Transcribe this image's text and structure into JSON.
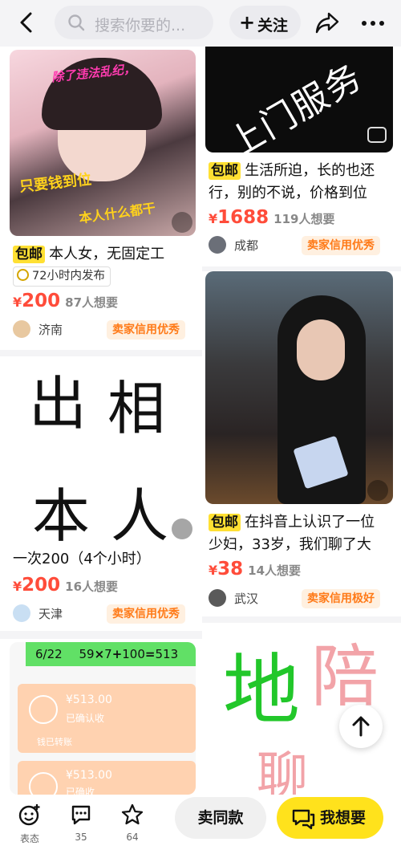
{
  "search": {
    "placeholder": "搜索你要的..."
  },
  "header": {
    "follow_label": "关注"
  },
  "cards": [
    {
      "overlay": [
        "除了违法乱纪，",
        "只要钱到位",
        "本人什么都干"
      ],
      "tag": "包邮",
      "title": "本人女，无固定工",
      "badge": "72小时内发布",
      "price_symbol": "¥",
      "price": "200",
      "want": "87人想要",
      "city": "济南",
      "credit": "卖家信用优秀"
    },
    {
      "overlay": [
        "上门服务"
      ],
      "tag": "包邮",
      "title_lines": [
        "生活所迫，长的也还",
        "行，别的不说，价格到位"
      ],
      "price_symbol": "¥",
      "price": "1688",
      "want": "119人想要",
      "city": "成都",
      "credit": "卖家信用优秀"
    },
    {
      "overlay": [
        "出",
        "相",
        "本",
        "人"
      ],
      "title": "一次200（4个小时）",
      "price_symbol": "¥",
      "price": "200",
      "want": "16人想要",
      "city": "天津",
      "credit": "卖家信用优秀"
    },
    {
      "tag": "包邮",
      "title_lines": [
        "在抖音上认识了一位",
        "少妇，33岁，我们聊了大"
      ],
      "price_symbol": "¥",
      "price": "38",
      "want": "14人想要",
      "city": "武汉",
      "credit": "卖家信用极好"
    },
    {
      "overlay_header": [
        "6/22",
        "59",
        "×",
        "7",
        "+",
        "100",
        "=",
        "513"
      ],
      "receipts": [
        {
          "amount": "¥513.00",
          "status": "已确认收",
          "sub": "钱已转账"
        },
        {
          "amount": "¥513.00",
          "status": "已确收"
        }
      ]
    },
    {
      "overlay": [
        "地",
        "陪",
        "聊"
      ]
    }
  ],
  "bottom": {
    "items": [
      {
        "label": "表态"
      },
      {
        "label": "35"
      },
      {
        "label": "64"
      }
    ],
    "same_label": "卖同款",
    "want_label": "我想要"
  },
  "colors": {
    "accent": "#ffe21c",
    "price": "#ff4c3a",
    "credit": "#ff7a18"
  }
}
